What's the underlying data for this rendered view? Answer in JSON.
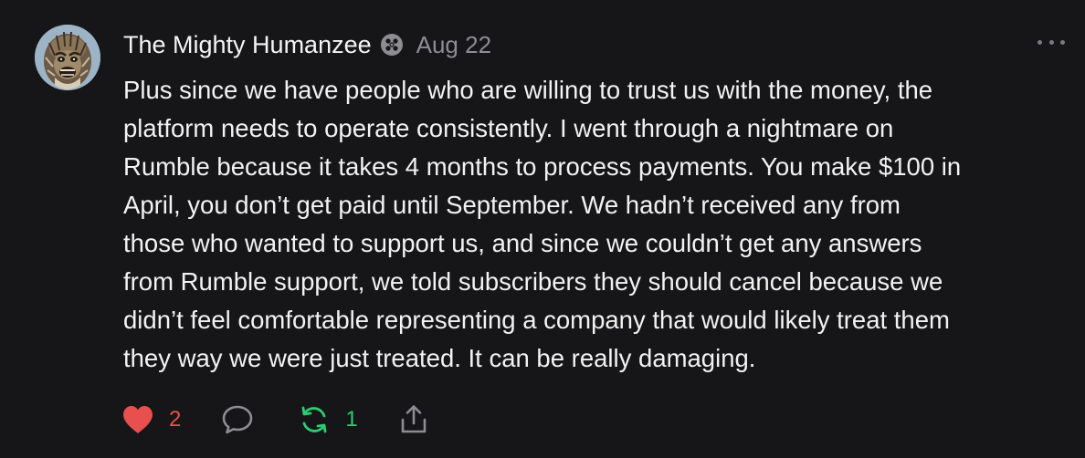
{
  "post": {
    "author": "The Mighty Humanzee",
    "date": "Aug 22",
    "badge_icon": "subscriber-badge-icon",
    "more_icon": "more-options-icon",
    "body_lines": [
      "Plus since we have people who are willing to trust us with the money, the",
      "platform needs to operate consistently. I went through a nightmare on",
      "Rumble because it takes 4 months to process payments. You make $100 in",
      "April, you don’t get paid until September. We hadn’t received any from",
      "those who wanted to support us, and since we couldn’t get any answers",
      "from Rumble support, we told subscribers they should cancel because we",
      "didn’t feel comfortable representing a company that would likely treat them",
      "they way we were just treated. It can be really damaging."
    ]
  },
  "actions": {
    "like": {
      "icon": "heart-icon",
      "count": "2",
      "color": "#e8504f"
    },
    "comment": {
      "icon": "comment-bubble-icon"
    },
    "restack": {
      "icon": "restack-icon",
      "count": "1",
      "color": "#2ecc71"
    },
    "share": {
      "icon": "share-icon"
    }
  },
  "colors": {
    "background": "#161618",
    "text": "#f2f2f2",
    "muted": "#8d8d92"
  }
}
